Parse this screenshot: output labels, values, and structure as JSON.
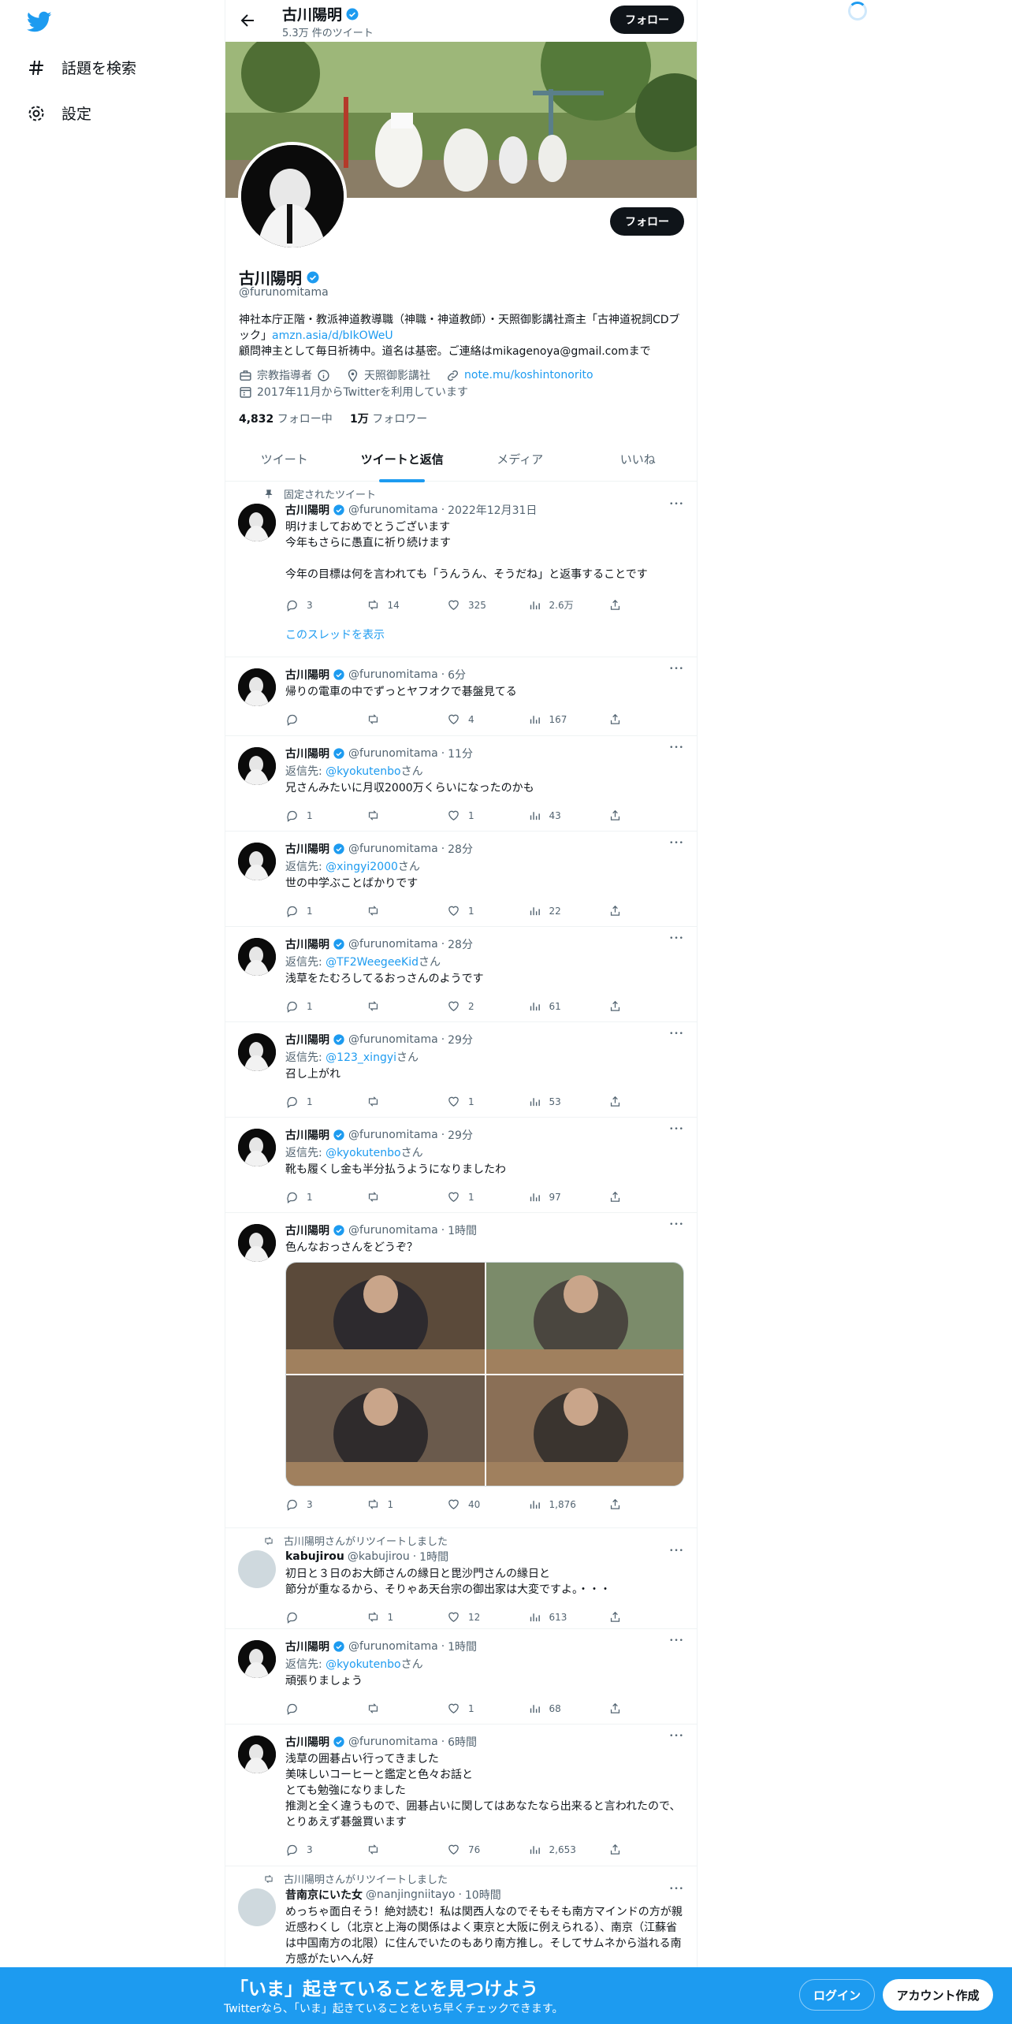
{
  "sidebar": {
    "logo": "twitter-bird-icon",
    "items": [
      {
        "label": "話題を検索",
        "icon": "hash-icon"
      },
      {
        "label": "設定",
        "icon": "gear-icon"
      }
    ]
  },
  "header": {
    "name": "古川陽明",
    "tweet_count": "5.3万 件のツイート",
    "follow_label": "フォロー"
  },
  "profile": {
    "name": "古川陽明",
    "handle": "@furunomitama",
    "follow_label": "フォロー",
    "bio_line1": "神社本庁正階・教派神道教導職（神職・神道教師）・天照御影講社斎主「古神道祝詞CDブック」",
    "bio_link": "amzn.asia/d/bIkOWeU",
    "bio_line2": "顧問神主として毎日祈祷中。道名は基密。ご連絡はmikagenoya@gmail.comまで",
    "category": "宗教指導者",
    "location": "天照御影講社",
    "url": "note.mu/koshintonorito",
    "joined": "2017年11月からTwitterを利用しています",
    "following_count": "4,832",
    "following_label": "フォロー中",
    "followers_count": "1万",
    "followers_label": "フォロワー"
  },
  "tabs": [
    {
      "label": "ツイート",
      "active": false
    },
    {
      "label": "ツイートと返信",
      "active": true
    },
    {
      "label": "メディア",
      "active": false
    },
    {
      "label": "いいね",
      "active": false
    }
  ],
  "pinned_label": "固定されたツイート",
  "show_thread": "このスレッドを表示",
  "reply_prefix": "返信先: ",
  "reply_suffix": "さん",
  "tweets": [
    {
      "name": "古川陽明",
      "handle": "@furunomitama",
      "time": "2022年12月31日",
      "text": "明けましておめでとうございます\n今年もさらに愚直に祈り続けます\n\n今年の目標は何を言われても「うんうん、そうだね」と返事することです",
      "replies": "3",
      "retweets": "14",
      "likes": "325",
      "views": "2.6万"
    },
    {
      "name": "古川陽明",
      "handle": "@furunomitama",
      "time": "6分",
      "text": "帰りの電車の中でずっとヤフオクで碁盤見てる",
      "replies": "",
      "retweets": "",
      "likes": "4",
      "views": "167"
    },
    {
      "name": "古川陽明",
      "handle": "@furunomitama",
      "time": "11分",
      "reply_to": "@kyokutenbo",
      "text": "兄さんみたいに月収2000万くらいになったのかも",
      "replies": "1",
      "retweets": "",
      "likes": "1",
      "views": "43"
    },
    {
      "name": "古川陽明",
      "handle": "@furunomitama",
      "time": "28分",
      "reply_to": "@xingyi2000",
      "text": "世の中学ぶことばかりです",
      "replies": "1",
      "retweets": "",
      "likes": "1",
      "views": "22"
    },
    {
      "name": "古川陽明",
      "handle": "@furunomitama",
      "time": "28分",
      "reply_to": "@TF2WeegeeKid",
      "text": "浅草をたむろしてるおっさんのようです",
      "replies": "1",
      "retweets": "",
      "likes": "2",
      "views": "61"
    },
    {
      "name": "古川陽明",
      "handle": "@furunomitama",
      "time": "29分",
      "reply_to": "@123_xingyi",
      "text": "召し上がれ",
      "replies": "1",
      "retweets": "",
      "likes": "1",
      "views": "53"
    },
    {
      "name": "古川陽明",
      "handle": "@furunomitama",
      "time": "29分",
      "reply_to": "@kyokutenbo",
      "text": "靴も履くし金も半分払うようになりましたわ",
      "replies": "1",
      "retweets": "",
      "likes": "1",
      "views": "97"
    },
    {
      "name": "古川陽明",
      "handle": "@furunomitama",
      "time": "1時間",
      "text": "色んなおっさんをどうぞ？",
      "replies": "3",
      "retweets": "1",
      "likes": "40",
      "views": "1,876"
    },
    {
      "retweeted_by": "古川陽明さんがリツイートしました",
      "name": "kabujirou",
      "handle": "@kabujirou",
      "time": "1時間",
      "text": "初日と３日のお大師さんの縁日と毘沙門さんの縁日と\n節分が重なるから、そりゃあ天台宗の御出家は大変ですよ。・・・",
      "replies": "",
      "retweets": "1",
      "likes": "12",
      "views": "613"
    },
    {
      "name": "古川陽明",
      "handle": "@furunomitama",
      "time": "1時間",
      "reply_to": "@kyokutenbo",
      "text": "頑張りましょう",
      "replies": "",
      "retweets": "",
      "likes": "1",
      "views": "68"
    },
    {
      "name": "古川陽明",
      "handle": "@furunomitama",
      "time": "6時間",
      "text": "浅草の囲碁占い行ってきました\n美味しいコーヒーと鑑定と色々お話と\nとても勉強になりました\n推測と全く違うもので、囲碁占いに関してはあなたなら出来ると言われたので、とりあえず碁盤買います",
      "replies": "3",
      "retweets": "",
      "likes": "76",
      "views": "2,653"
    },
    {
      "retweeted_by": "古川陽明さんがリツイートしました",
      "name": "昔南京にいた女",
      "handle": "@nanjingniitayo",
      "time": "10時間",
      "text": "めっちゃ面白そう！絶対読む！私は関西人なのでそもそも南方マインドの方が親近感わくし（北京と上海の関係はよく東京と大阪に例えられる）、南京（江蘇省は中国南方の北限）に住んでいたのもあり南方推し。そしてサムネから溢れる南方感がたいへん好"
    }
  ],
  "cta": {
    "heading": "「いま」起きていることを見つけよう",
    "sub": "Twitterなら、「いま」起きていることをいち早くチェックできます。",
    "login": "ログイン",
    "signup": "アカウント作成"
  },
  "colors": {
    "accent": "#1d9bf0",
    "text": "#0f1419",
    "muted": "#536471"
  }
}
